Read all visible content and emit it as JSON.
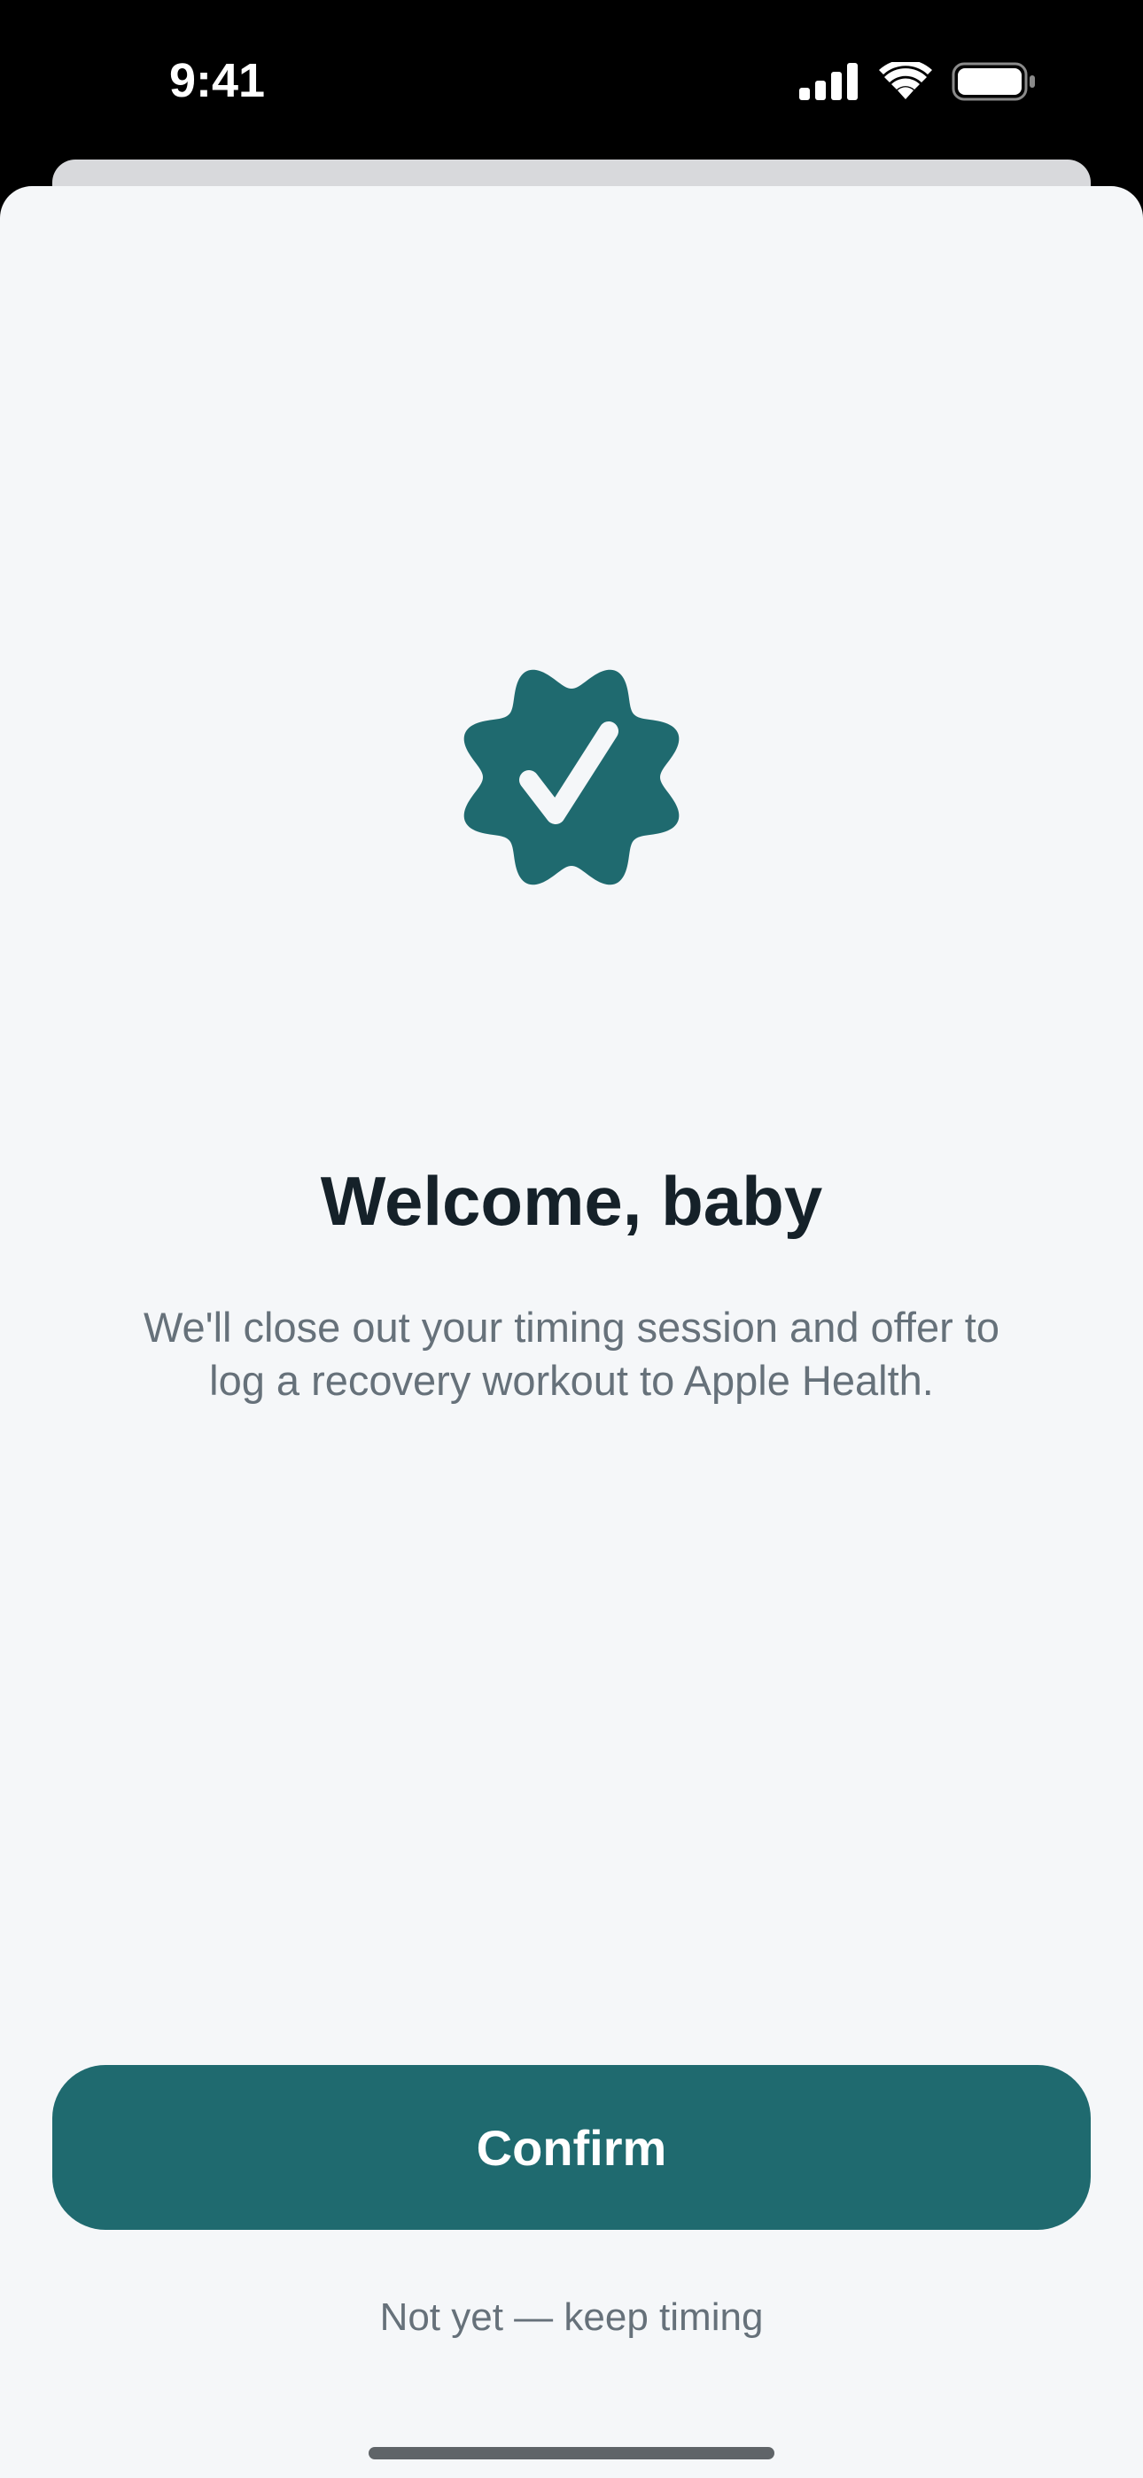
{
  "status_bar": {
    "time": "9:41",
    "icons": [
      "cellular-signal-icon",
      "wifi-icon",
      "battery-icon"
    ]
  },
  "sheet": {
    "badge_icon": "verified-checkmark-badge-icon",
    "title": "Welcome, baby",
    "subtitle": "We'll close out your timing session and offer to log a recovery workout to Apple Health.",
    "confirm_label": "Confirm",
    "secondary_label": "Not yet — keep timing"
  },
  "colors": {
    "accent": "#1f6a6f",
    "sheet_background": "#f5f7f9",
    "title_text": "#152129",
    "secondary_text": "#66717a",
    "status_bar_background": "#000000"
  }
}
